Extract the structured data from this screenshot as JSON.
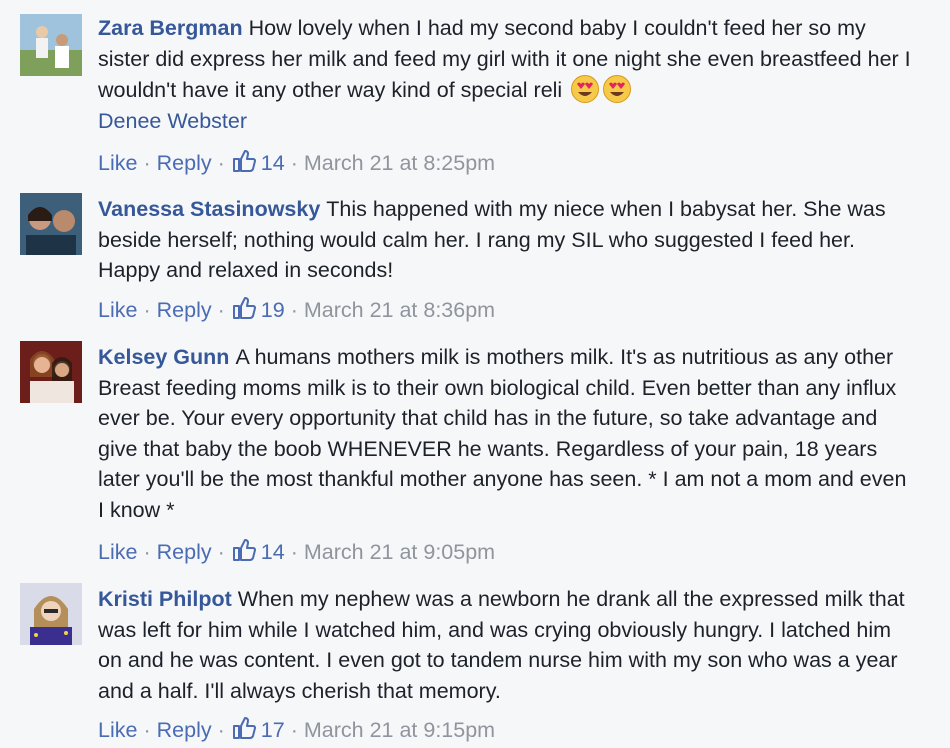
{
  "comments": [
    {
      "author": "Zara Bergman",
      "text": "How lovely when I had my second baby I couldn't feed her so my sister did express her milk and feed my girl with it one night she even breastfeed her I wouldn't have it any other way kind of special reli",
      "emoji": [
        "heart-eyes-emoji",
        "heart-eyes-emoji"
      ],
      "mention": "Denee Webster",
      "like_label": "Like",
      "reply_label": "Reply",
      "likes": "14",
      "timestamp": "March 21 at 8:25pm"
    },
    {
      "author": "Vanessa Stasinowsky",
      "text": "This happened with my niece when I babysat her. She was beside herself; nothing would calm her. I rang my SIL who suggested I feed her. Happy and relaxed in seconds!",
      "like_label": "Like",
      "reply_label": "Reply",
      "likes": "19",
      "timestamp": "March 21 at 8:36pm"
    },
    {
      "author": "Kelsey Gunn",
      "text": "A humans mothers milk is mothers milk. It's as nutritious as any other Breast feeding moms milk is to their own biological child. Even better than any influx ever be. Your every opportunity that child has in the future, so take advantage and give that baby the boob WHENEVER he wants. Regardless of your pain, 18 years later you'll be the most thankful mother anyone has seen. * I am not a mom and even I know *",
      "like_label": "Like",
      "reply_label": "Reply",
      "likes": "14",
      "timestamp": "March 21 at 9:05pm"
    },
    {
      "author": "Kristi Philpot",
      "text": "When my nephew was a newborn he drank all the expressed milk that was left for him while I watched him, and was crying obviously hungry. I latched him on and he was content. I even got to tandem nurse him with my son who was a year and a half. I'll always cherish that memory.",
      "like_label": "Like",
      "reply_label": "Reply",
      "likes": "17",
      "timestamp": "March 21 at 9:15pm"
    }
  ],
  "colors": {
    "background": "#f6f7f9",
    "author": "#365899",
    "text": "#1d2129",
    "link": "#4b6bb3",
    "meta": "#90949c",
    "like_icon": "#4b6bb3"
  }
}
